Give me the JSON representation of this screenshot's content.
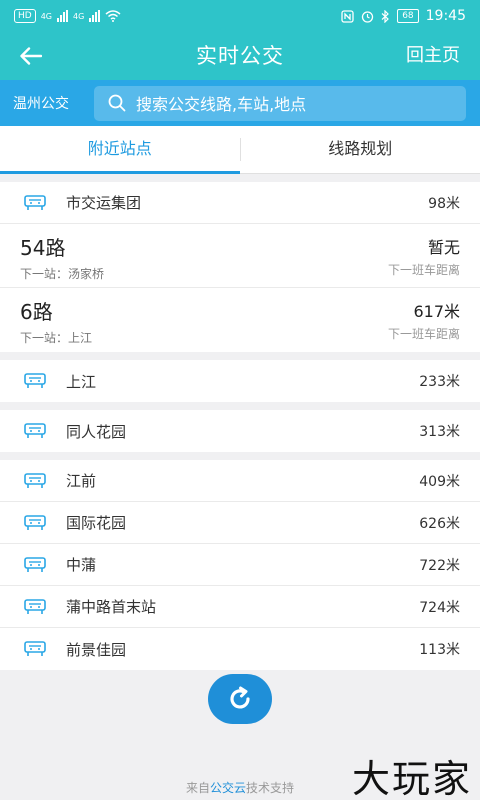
{
  "status_bar": {
    "left_badge": "HD",
    "net1": "4G",
    "net2": "4G",
    "battery": "68",
    "time": "19:45"
  },
  "header": {
    "title": "实时公交",
    "home_label": "回主页"
  },
  "search": {
    "city": "温州公交",
    "placeholder": "搜索公交线路,车站,地点"
  },
  "tabs": [
    {
      "label": "附近站点",
      "active": true
    },
    {
      "label": "线路规划",
      "active": false
    }
  ],
  "first_stop": {
    "name": "市交运集团",
    "distance": "98米"
  },
  "routes": [
    {
      "name": "54路",
      "next": "下一站：汤家桥",
      "value": "暂无",
      "sub": "下一班车距离"
    },
    {
      "name": "6路",
      "next": "下一站：上江",
      "value": "617米",
      "sub": "下一班车距离"
    }
  ],
  "stops_b": [
    {
      "name": "上江",
      "distance": "233米"
    }
  ],
  "stops_c": [
    {
      "name": "同人花园",
      "distance": "313米"
    }
  ],
  "stops_d": [
    {
      "name": "江前",
      "distance": "409米"
    },
    {
      "name": "国际花园",
      "distance": "626米"
    },
    {
      "name": "中蒲",
      "distance": "722米"
    },
    {
      "name": "蒲中路首末站",
      "distance": "724米"
    },
    {
      "name": "前景佳园",
      "distance": "113米"
    }
  ],
  "footer": {
    "prefix": "来自",
    "brand": "公交云",
    "suffix": "技术支持"
  },
  "watermark": "大玩家",
  "colors": {
    "header": "#2ec4c9",
    "search_bar": "#2aa7e6",
    "accent": "#1f9be0"
  }
}
